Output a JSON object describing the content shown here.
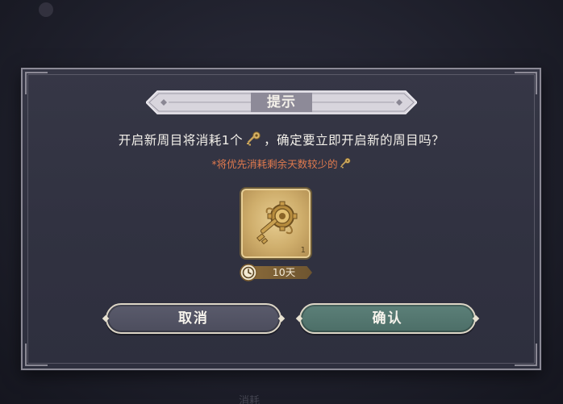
{
  "background": {
    "bottom_text": "消耗"
  },
  "dialog": {
    "title": "提示",
    "message_before": "开启新周目将消耗1个",
    "message_after": "，确定要立即开启新的周目吗？",
    "note": "*将优先消耗剩余天数较少的",
    "item": {
      "icon": "golden-key-icon",
      "count": "1",
      "duration": "10天"
    },
    "buttons": {
      "cancel_label": "取消",
      "confirm_label": "确认"
    }
  },
  "colors": {
    "dialog_bg": "#333444",
    "title_banner": "#d9d6de",
    "note_text": "#e07a4e",
    "cancel_button": "#535466",
    "confirm_button": "#557870",
    "item_gold": "#d6b676"
  }
}
